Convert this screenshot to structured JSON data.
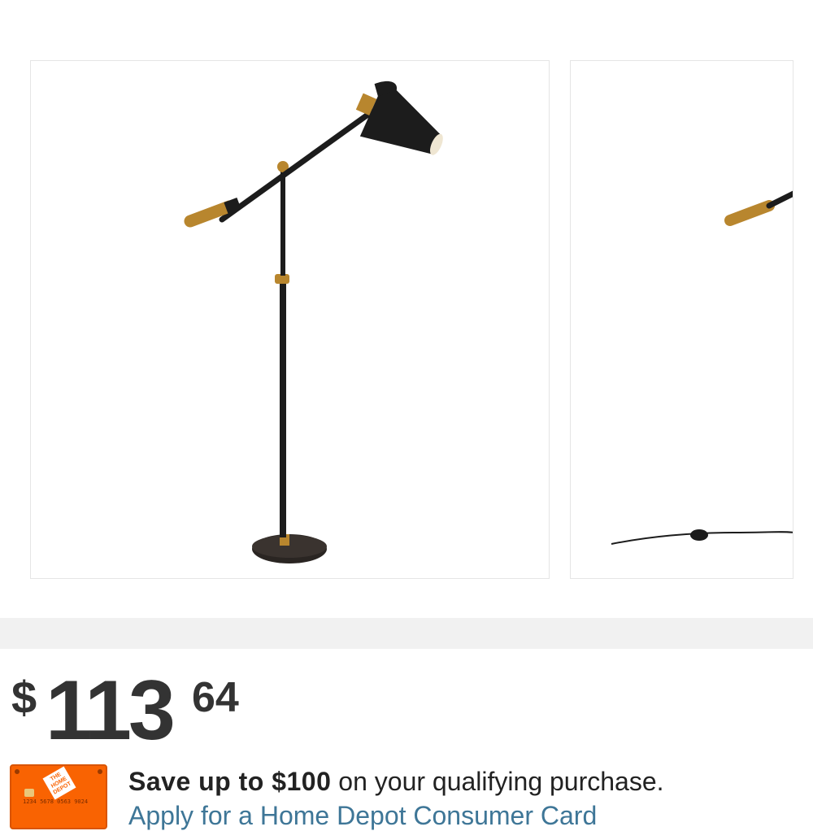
{
  "gallery": {
    "images": [
      {
        "alt": "",
        "icon": "floor-lamp-image"
      },
      {
        "alt": "",
        "icon": "floor-lamp-image"
      }
    ]
  },
  "price": {
    "currency": "$",
    "dollars": "113",
    "cents": "64"
  },
  "promo": {
    "bold_text": "Save up to $100",
    "text": " on your qualifying purchase.",
    "link": "Apply for a Home Depot Consumer Card",
    "card_icon": "credit-card-icon",
    "card_logo": "THE HOME DEPOT",
    "card_number": "1234 5678 0563 9024"
  },
  "colors": {
    "accent": "#f96302",
    "link": "#3e7697",
    "lamp_black": "#1c1c1c",
    "lamp_brass": "#b8862e"
  }
}
